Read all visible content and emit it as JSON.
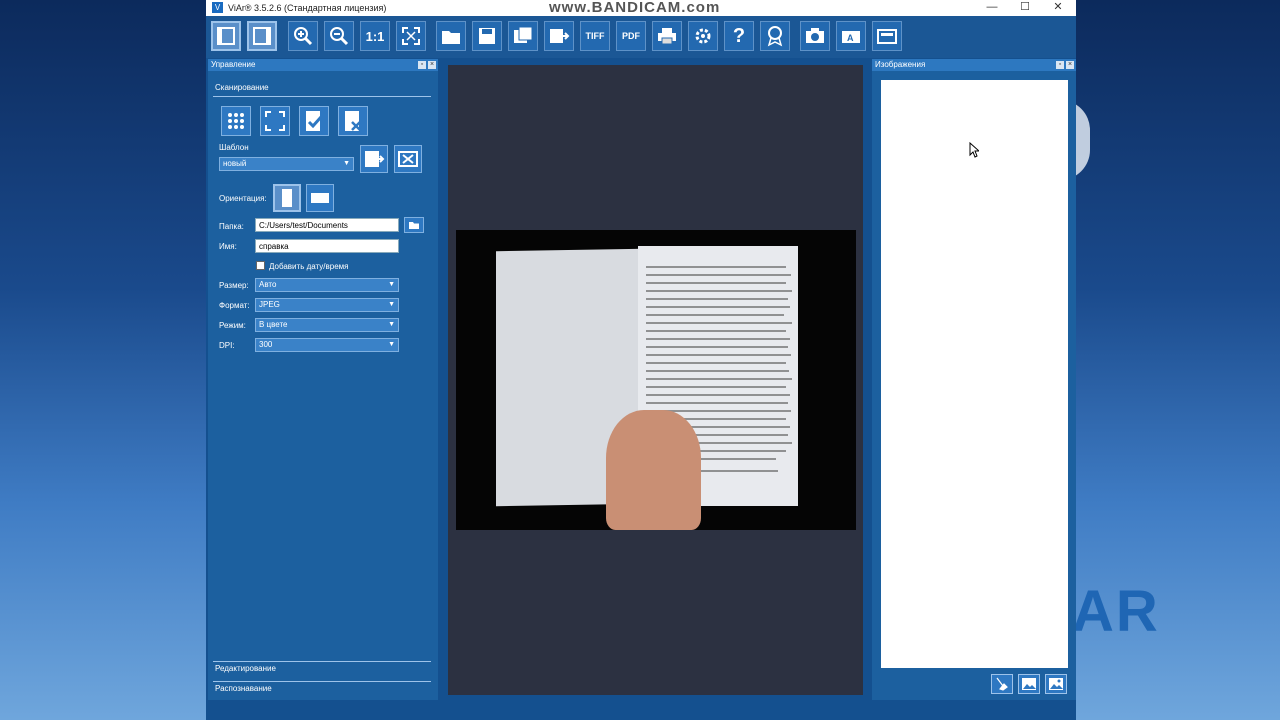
{
  "window": {
    "title": "ViAr® 3.5.2.6 (Стандартная лицензия)",
    "app_icon": "V",
    "watermark": "www.BANDICAM.com",
    "minimize": "—",
    "maximize": "☐",
    "close": "✕"
  },
  "toolbar": {
    "zoom_1to1": "1:1",
    "tiff": "TIFF",
    "pdf": "PDF",
    "help": "?"
  },
  "left_panel": {
    "header": "Управление",
    "scan_section": "Сканирование",
    "template_label": "Шаблон",
    "template_value": "новый",
    "orientation_label": "Ориентация:",
    "folder_label": "Папка:",
    "folder_value": "C:/Users/test/Documents",
    "name_label": "Имя:",
    "name_value": "справка",
    "add_date_label": "Добавить дату/время",
    "size_label": "Размер:",
    "size_value": "Авто",
    "format_label": "Формат:",
    "format_value": "JPEG",
    "mode_label": "Режим:",
    "mode_value": "В цвете",
    "dpi_label": "DPI:",
    "dpi_value": "300",
    "edit_section": "Редактирование",
    "recog_section": "Распознавание"
  },
  "right_panel": {
    "header": "Изображения"
  },
  "desktop": {
    "logo": "AR"
  }
}
